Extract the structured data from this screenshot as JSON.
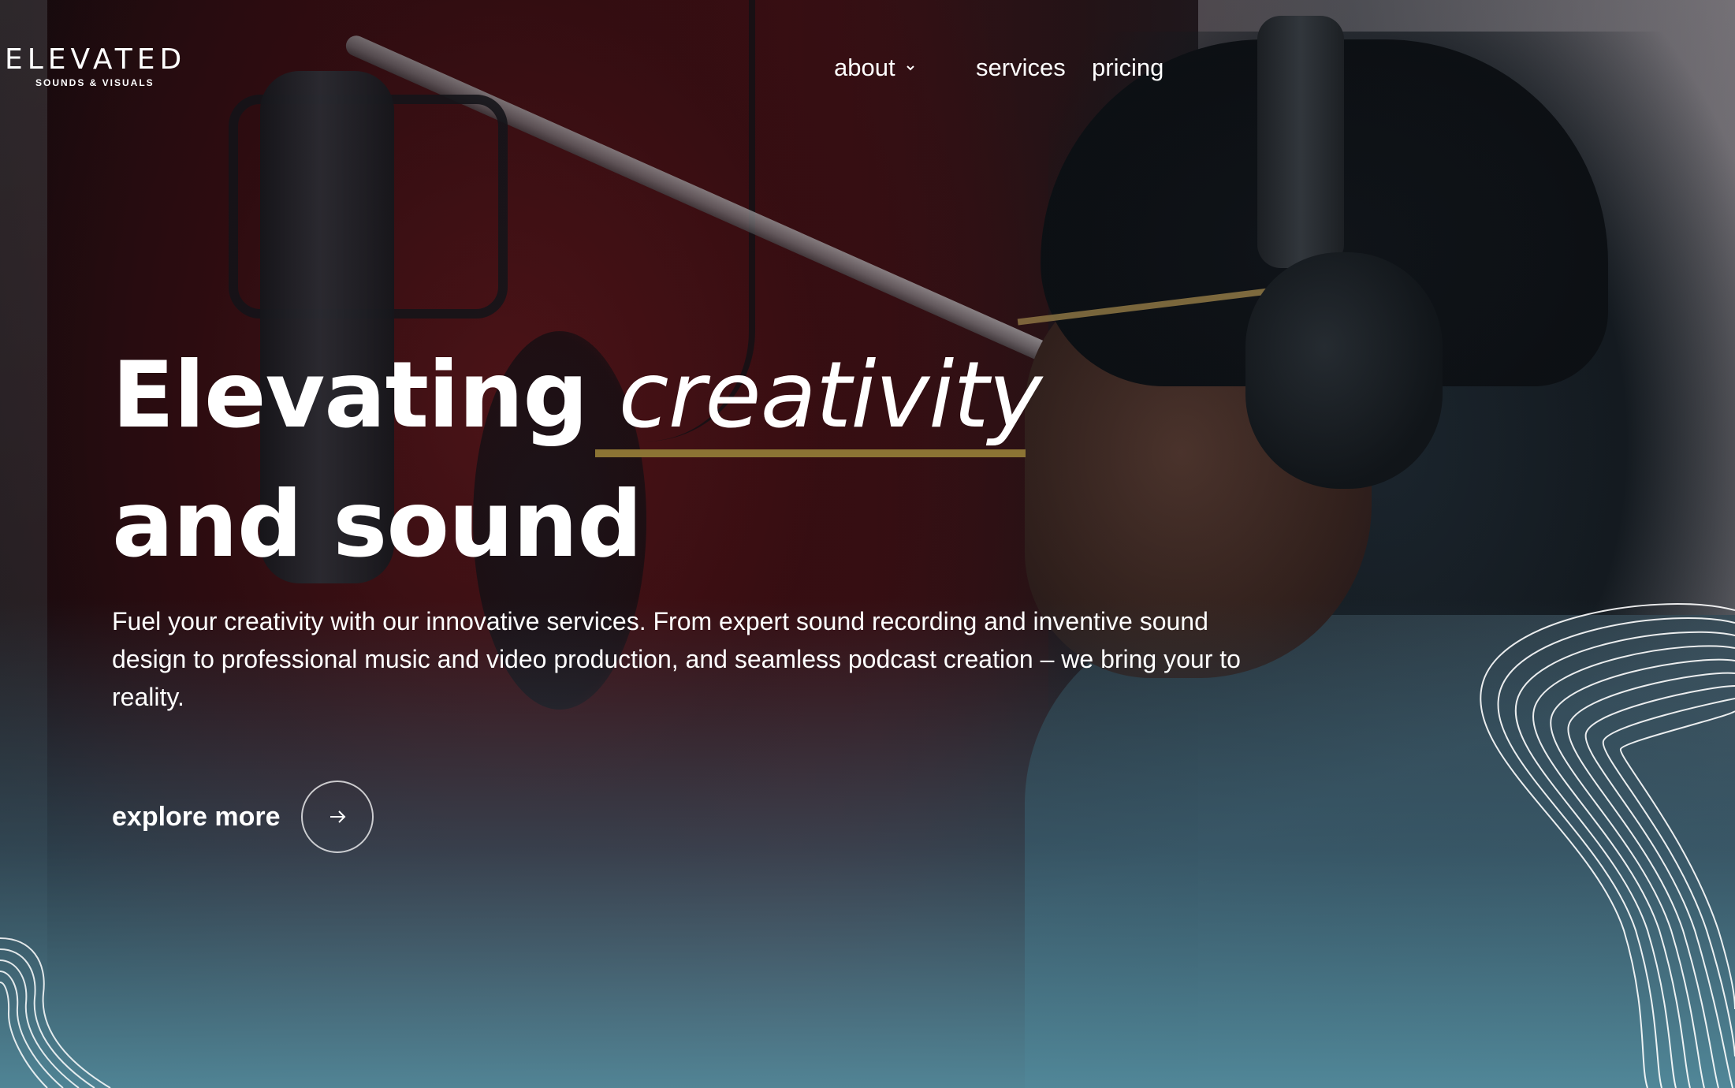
{
  "brand": {
    "name": "ELEVATED",
    "tagline": "SOUNDS & VISUALS",
    "accent_color": "#c9a94f"
  },
  "nav": {
    "items": [
      {
        "label": "about",
        "has_dropdown": true
      },
      {
        "label": "services"
      },
      {
        "label": "pricing"
      }
    ]
  },
  "hero": {
    "headline_part1": "Elevating",
    "headline_italic": "creativity",
    "headline_line2": "and sound",
    "underline_color": "#8c7434",
    "description": "Fuel your creativity with our innovative services. From expert sound recording and inventive sound design to professional music and video production, and seamless podcast creation – we bring your to reality.",
    "cta_label": "explore more",
    "cta_icon": "arrow-right-icon"
  },
  "background": {
    "image": "studio-vocalist-with-headphones-icon",
    "decor": "contour-lines-icon"
  }
}
